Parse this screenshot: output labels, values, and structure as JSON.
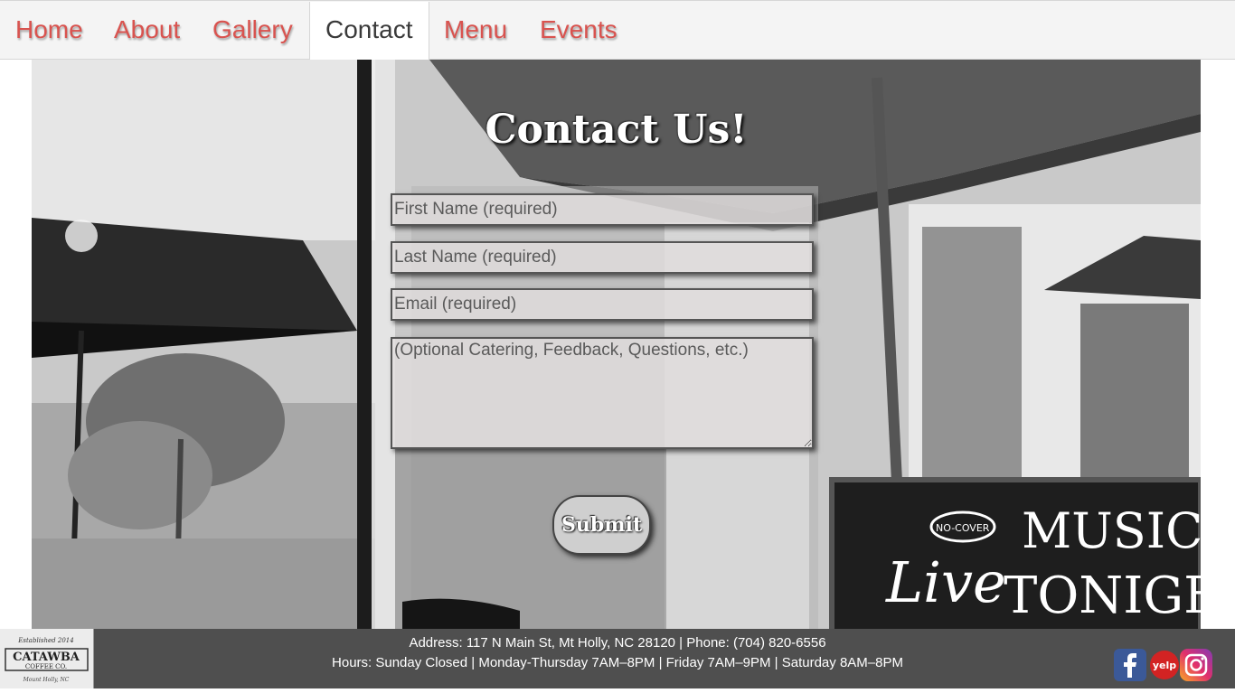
{
  "nav": {
    "tabs": [
      {
        "label": "Home"
      },
      {
        "label": "About"
      },
      {
        "label": "Gallery"
      },
      {
        "label": "Contact"
      },
      {
        "label": "Menu"
      },
      {
        "label": "Events"
      }
    ],
    "active": "Contact"
  },
  "colors": {
    "nav_link": "#d9534f",
    "nav_active": "#3a3a3a",
    "footer_bg": "#373737"
  },
  "contact": {
    "title": "Contact Us!",
    "first_name_placeholder": "First Name (required)",
    "last_name_placeholder": "Last Name (required)",
    "email_placeholder": "Email (required)",
    "message_placeholder": "(Optional Catering, Feedback, Questions, etc.)",
    "submit_label": "Submit"
  },
  "hero_sign": {
    "line1": "MUSIC",
    "badge": "NO-COVER",
    "line2": "Live",
    "line3": "TONIGHT"
  },
  "footer": {
    "address_line": "Address: 117 N Main St, Mt Holly, NC 28120 | Phone: (704) 820-6556",
    "hours_line": "Hours: Sunday Closed | Monday-Thursday 7AM–8PM | Friday 7AM–9PM | Saturday 8AM–8PM",
    "logo": {
      "established": "Established 2014",
      "name": "CATAWBA",
      "sub": "COFFEE CO.",
      "town": "Mount Holly, NC"
    },
    "social_icons": [
      "facebook-icon",
      "yelp-icon",
      "instagram-icon"
    ],
    "yelp_text": "yelp"
  }
}
